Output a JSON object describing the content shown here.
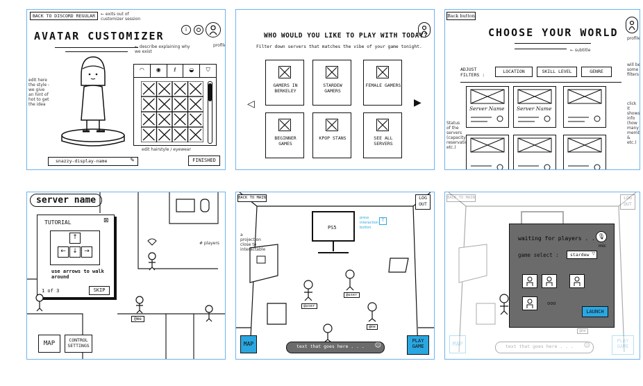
{
  "panel1": {
    "back_button": "BACK TO DISCORD REGULAR",
    "back_note": "← exits out of customizer session",
    "title": "AVATAR CUSTOMIZER",
    "title_note": "← describe explaining why we exist",
    "info_icon": "i",
    "profile_note": "profile",
    "avatar_note": "edit here the style - we give an hint of hot to get the idea",
    "tabs": [
      "hat",
      "eye",
      "hair",
      "mouth",
      "shirt"
    ],
    "grid_note": "edit hairstyle / eyewear",
    "name_value": "snazzy-display-name",
    "finished_button": "FINISHED"
  },
  "panel2": {
    "title": "WHO WOULD YOU LIKE TO PLAY WITH TODAY?",
    "subtitle": "Filter down servers that matches the vibe of your game tonight.",
    "cards": [
      "GAMERS IN BERKELEY",
      "STARDEW GAMERS",
      "FEMALE GAMERS",
      "BEGINNER GAMES",
      "KPOP STANS",
      "SEE ALL SERVERS"
    ]
  },
  "panel3": {
    "back_button": "Back button",
    "title": "CHOOSE YOUR WORLD",
    "title_note": "← subtitle",
    "profile_note": "profile",
    "filters_label": "ADJUST FILTERS :",
    "filters": [
      "LOCATION",
      "SKILL LEVEL",
      "GENRE"
    ],
    "filter_note": "will be some filters",
    "cards": [
      "Server Name",
      "Server Name",
      ""
    ],
    "side_note_left": "Status of the servers (capacity, reservation, etc.)",
    "side_note_right": "click it shows info (how many members & etc.)"
  },
  "panel4": {
    "server_title": "server name",
    "tutorial_title": "TUTORIAL",
    "tutorial_text": "use arrows to walk around",
    "tutorial_page": "1 of 3",
    "skip_button": "SKIP",
    "me_label": "@me",
    "player_note": "# players",
    "map_button": "MAP",
    "control_button": "CONTROL SETTINGS"
  },
  "panel5": {
    "back_button": "BACK TO MAIN",
    "logout_button": "LOG OUT",
    "screen_label": "PS5",
    "screen_note": "press interaction button",
    "left_note": "a projection close to interactable",
    "tags": [
      "@user",
      "@user",
      "@me"
    ],
    "map_button": "MAP",
    "chat_placeholder": "text that goes here . . .",
    "play_button": "PLAY GAME"
  },
  "panel6": {
    "back_button": "BACK TO MAIN",
    "logout_button": "LOG OUT",
    "modal_title": "waiting for players . . .",
    "game_select_label": "game select :",
    "game_select_value": "stardew",
    "mic_label": "mic",
    "dots": "ooo",
    "launch_button": "LAUNCH",
    "map_button": "MAP",
    "chat_placeholder": "text that goes here . . .",
    "play_button": "PLAY GAME",
    "me_label": "@me"
  },
  "colors": {
    "panel_border": "#6cb3ef",
    "accent": "#2aa7e1",
    "modal": "#6b6b6b"
  }
}
